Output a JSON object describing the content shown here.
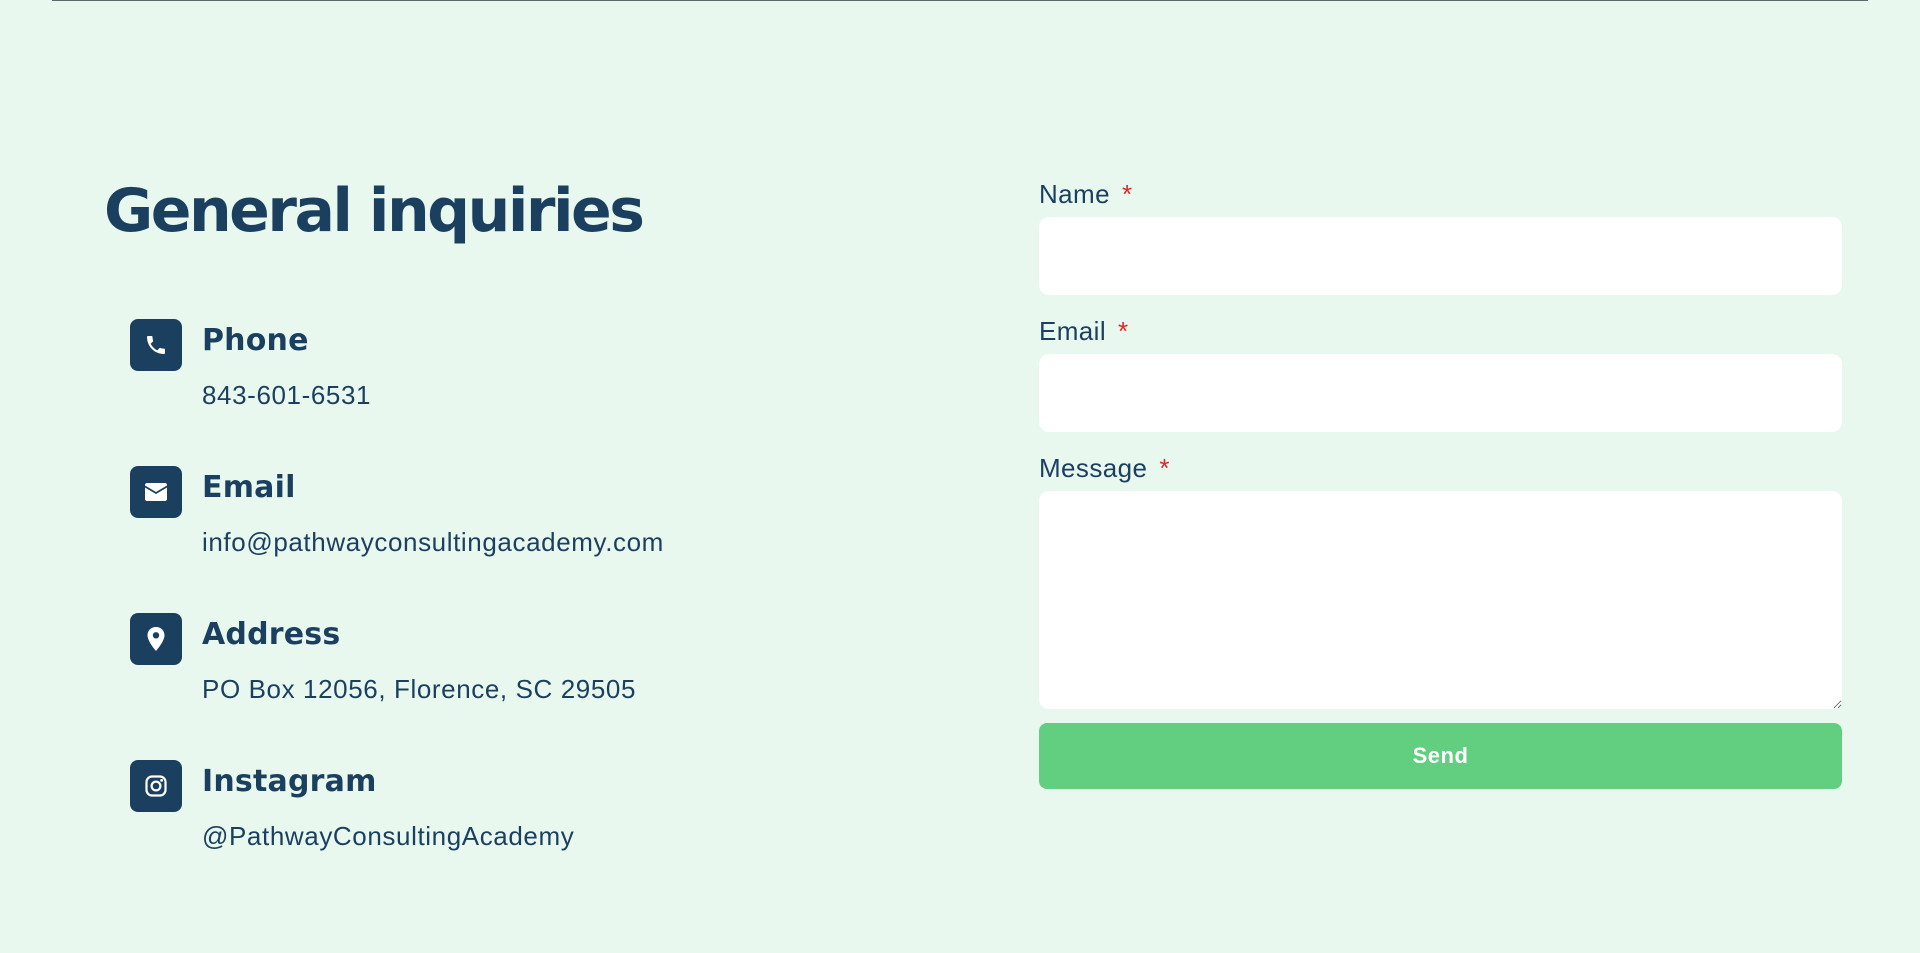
{
  "contact": {
    "title": "General inquiries",
    "items": [
      {
        "icon": "phone-icon",
        "heading": "Phone",
        "value": "843-601-6531"
      },
      {
        "icon": "envelope-icon",
        "heading": "Email",
        "value": "info@pathwayconsultingacademy.com"
      },
      {
        "icon": "map-pin-icon",
        "heading": "Address",
        "value": "PO Box 12056, Florence, SC 29505"
      },
      {
        "icon": "instagram-icon",
        "heading": "Instagram",
        "value": "@PathwayConsultingAcademy"
      }
    ]
  },
  "form": {
    "name": {
      "label": "Name",
      "required_mark": "*",
      "value": ""
    },
    "email": {
      "label": "Email",
      "required_mark": "*",
      "value": ""
    },
    "message": {
      "label": "Message",
      "required_mark": "*",
      "value": ""
    },
    "submit_label": "Send"
  },
  "colors": {
    "background": "#e8f8ef",
    "primary": "#1b3f5e",
    "accent": "#62cf80",
    "required": "#e02424"
  }
}
